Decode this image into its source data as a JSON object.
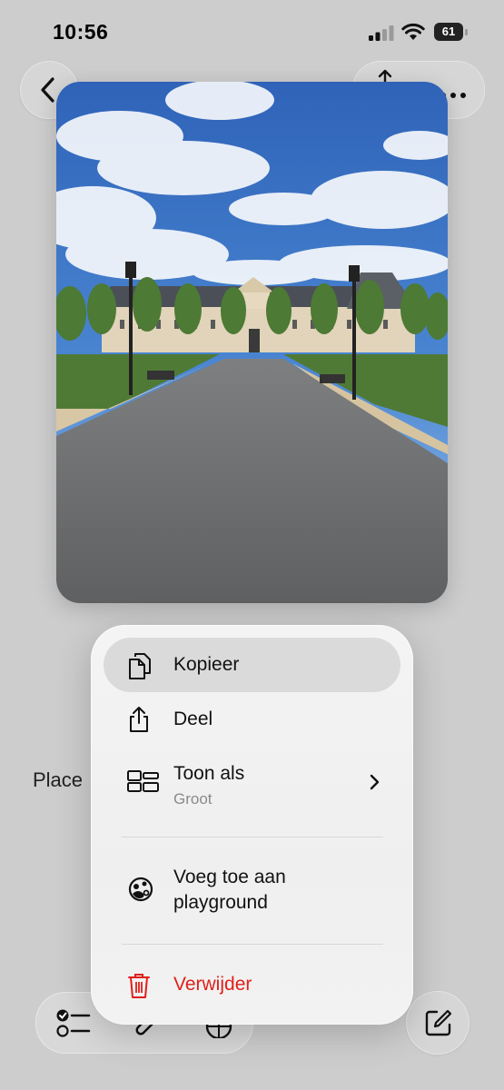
{
  "status_bar": {
    "time": "10:56",
    "battery_level": "61"
  },
  "note": {
    "placeholder_text": "Place"
  },
  "context_menu": {
    "items": [
      {
        "label": "Kopieer",
        "icon": "copy-icon"
      },
      {
        "label": "Deel",
        "icon": "share-icon"
      },
      {
        "label": "Toon als",
        "sublabel": "Groot",
        "icon": "view-layout-icon",
        "has_submenu": true
      },
      {
        "label": "Voeg toe aan playground",
        "icon": "playground-icon"
      },
      {
        "label": "Verwijder",
        "icon": "trash-icon",
        "color": "#e0201b"
      }
    ]
  },
  "top_bar": {
    "left_icon": "chevron-left-icon",
    "right_icons": [
      "share-icon",
      "more-icon"
    ]
  },
  "bottom_toolbar": {
    "icons": [
      "checklist-icon",
      "attach-icon",
      "draw-icon",
      "compose-icon"
    ]
  },
  "image": {
    "description_icon": "photo"
  }
}
